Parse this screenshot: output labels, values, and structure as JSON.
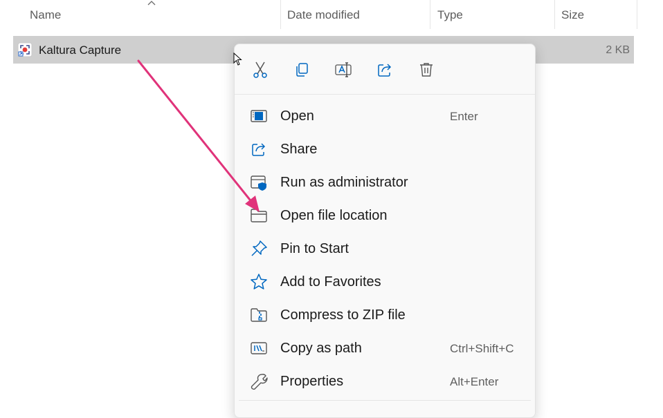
{
  "columns": {
    "name": "Name",
    "date_modified": "Date modified",
    "type": "Type",
    "size": "Size"
  },
  "file": {
    "name": "Kaltura Capture",
    "size": "2 KB",
    "icon": "kaltura-app-icon"
  },
  "toolbar": [
    "cut-icon",
    "copy-icon",
    "rename-icon",
    "share-icon",
    "delete-icon"
  ],
  "menu": {
    "items": [
      {
        "label": "Open",
        "shortcut": "Enter",
        "icon": "open-app-icon"
      },
      {
        "label": "Share",
        "shortcut": "",
        "icon": "share-icon"
      },
      {
        "label": "Run as administrator",
        "shortcut": "",
        "icon": "admin-shield-icon"
      },
      {
        "label": "Open file location",
        "shortcut": "",
        "icon": "folder-icon"
      },
      {
        "label": "Pin to Start",
        "shortcut": "",
        "icon": "pin-icon"
      },
      {
        "label": "Add to Favorites",
        "shortcut": "",
        "icon": "star-icon"
      },
      {
        "label": "Compress to ZIP file",
        "shortcut": "",
        "icon": "zip-folder-icon"
      },
      {
        "label": "Copy as path",
        "shortcut": "Ctrl+Shift+C",
        "icon": "copy-path-icon"
      },
      {
        "label": "Properties",
        "shortcut": "Alt+Enter",
        "icon": "wrench-icon"
      }
    ]
  },
  "annotation": {
    "color": "#e0337a"
  },
  "colors": {
    "accent": "#0067c0",
    "selection": "#cfcfcf"
  }
}
